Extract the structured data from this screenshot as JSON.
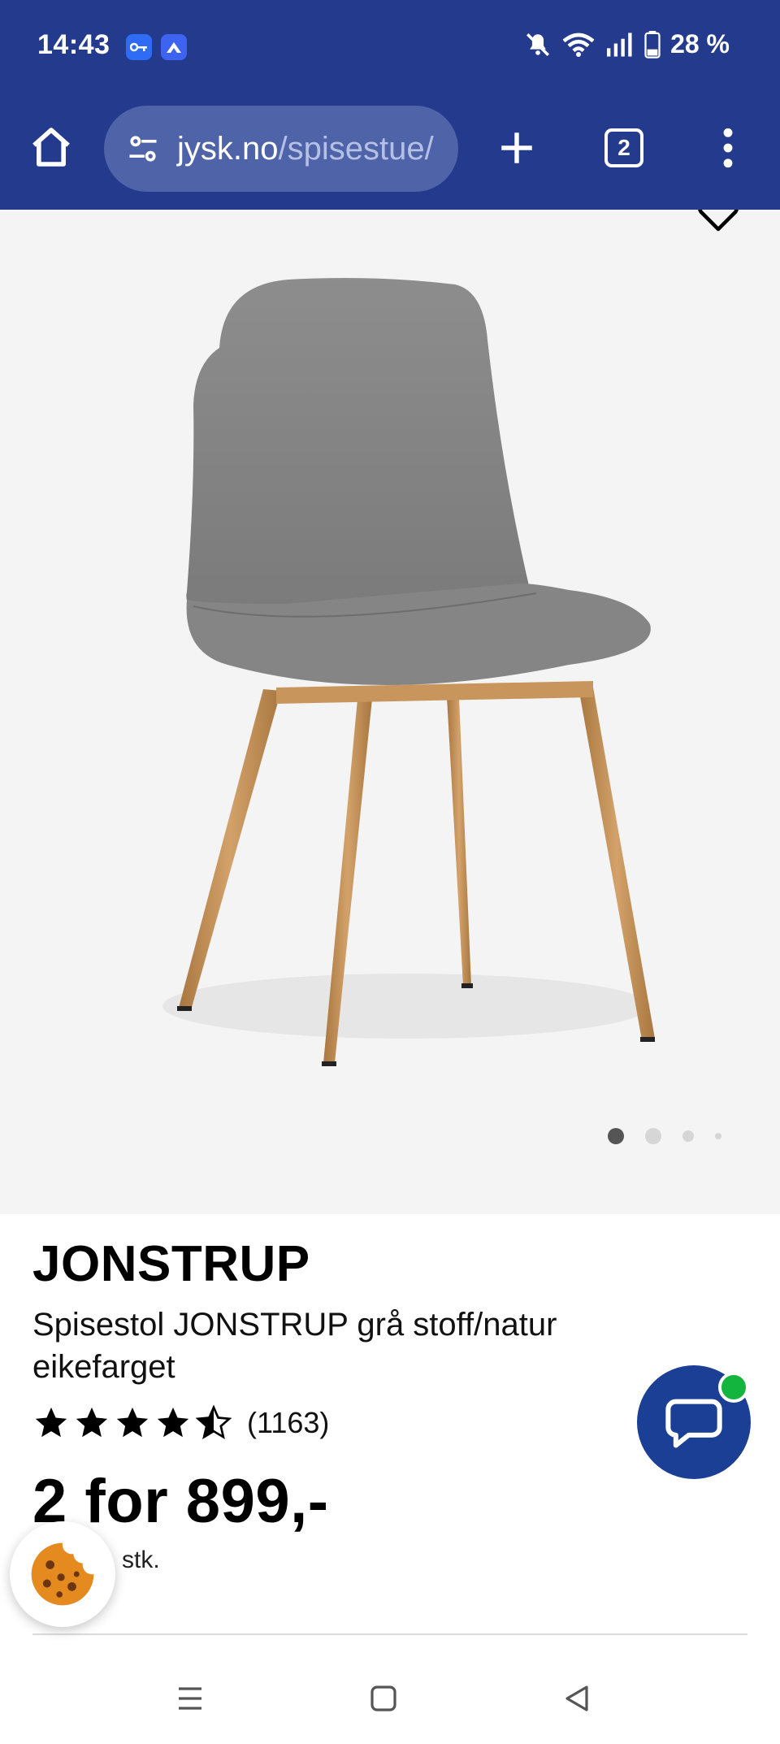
{
  "status_bar": {
    "time": "14:43",
    "battery": "28 %",
    "icons": [
      "vpn-key-icon",
      "app-icon",
      "mute-bell-icon",
      "wifi-icon",
      "signal-icon",
      "battery-icon"
    ]
  },
  "browser": {
    "url_domain": "jysk.no",
    "url_path": "/spisestue/",
    "tab_count": "2",
    "accent_color": "#233a8d"
  },
  "gallery": {
    "image_alt": "Grey upholstered dining chair with oak-look legs",
    "slide_count": 4,
    "active_slide": 1
  },
  "product": {
    "brand": "JONSTRUP",
    "description": "Spisestol JONSTRUP grå stoff/natur eikefarget",
    "rating_count": "(1163)",
    "rating_value": 4.5,
    "price": "2 for 899,-",
    "unit_note": "stk."
  },
  "colors": {
    "chat_button": "#1a3f94",
    "online_indicator": "#13b53f"
  }
}
